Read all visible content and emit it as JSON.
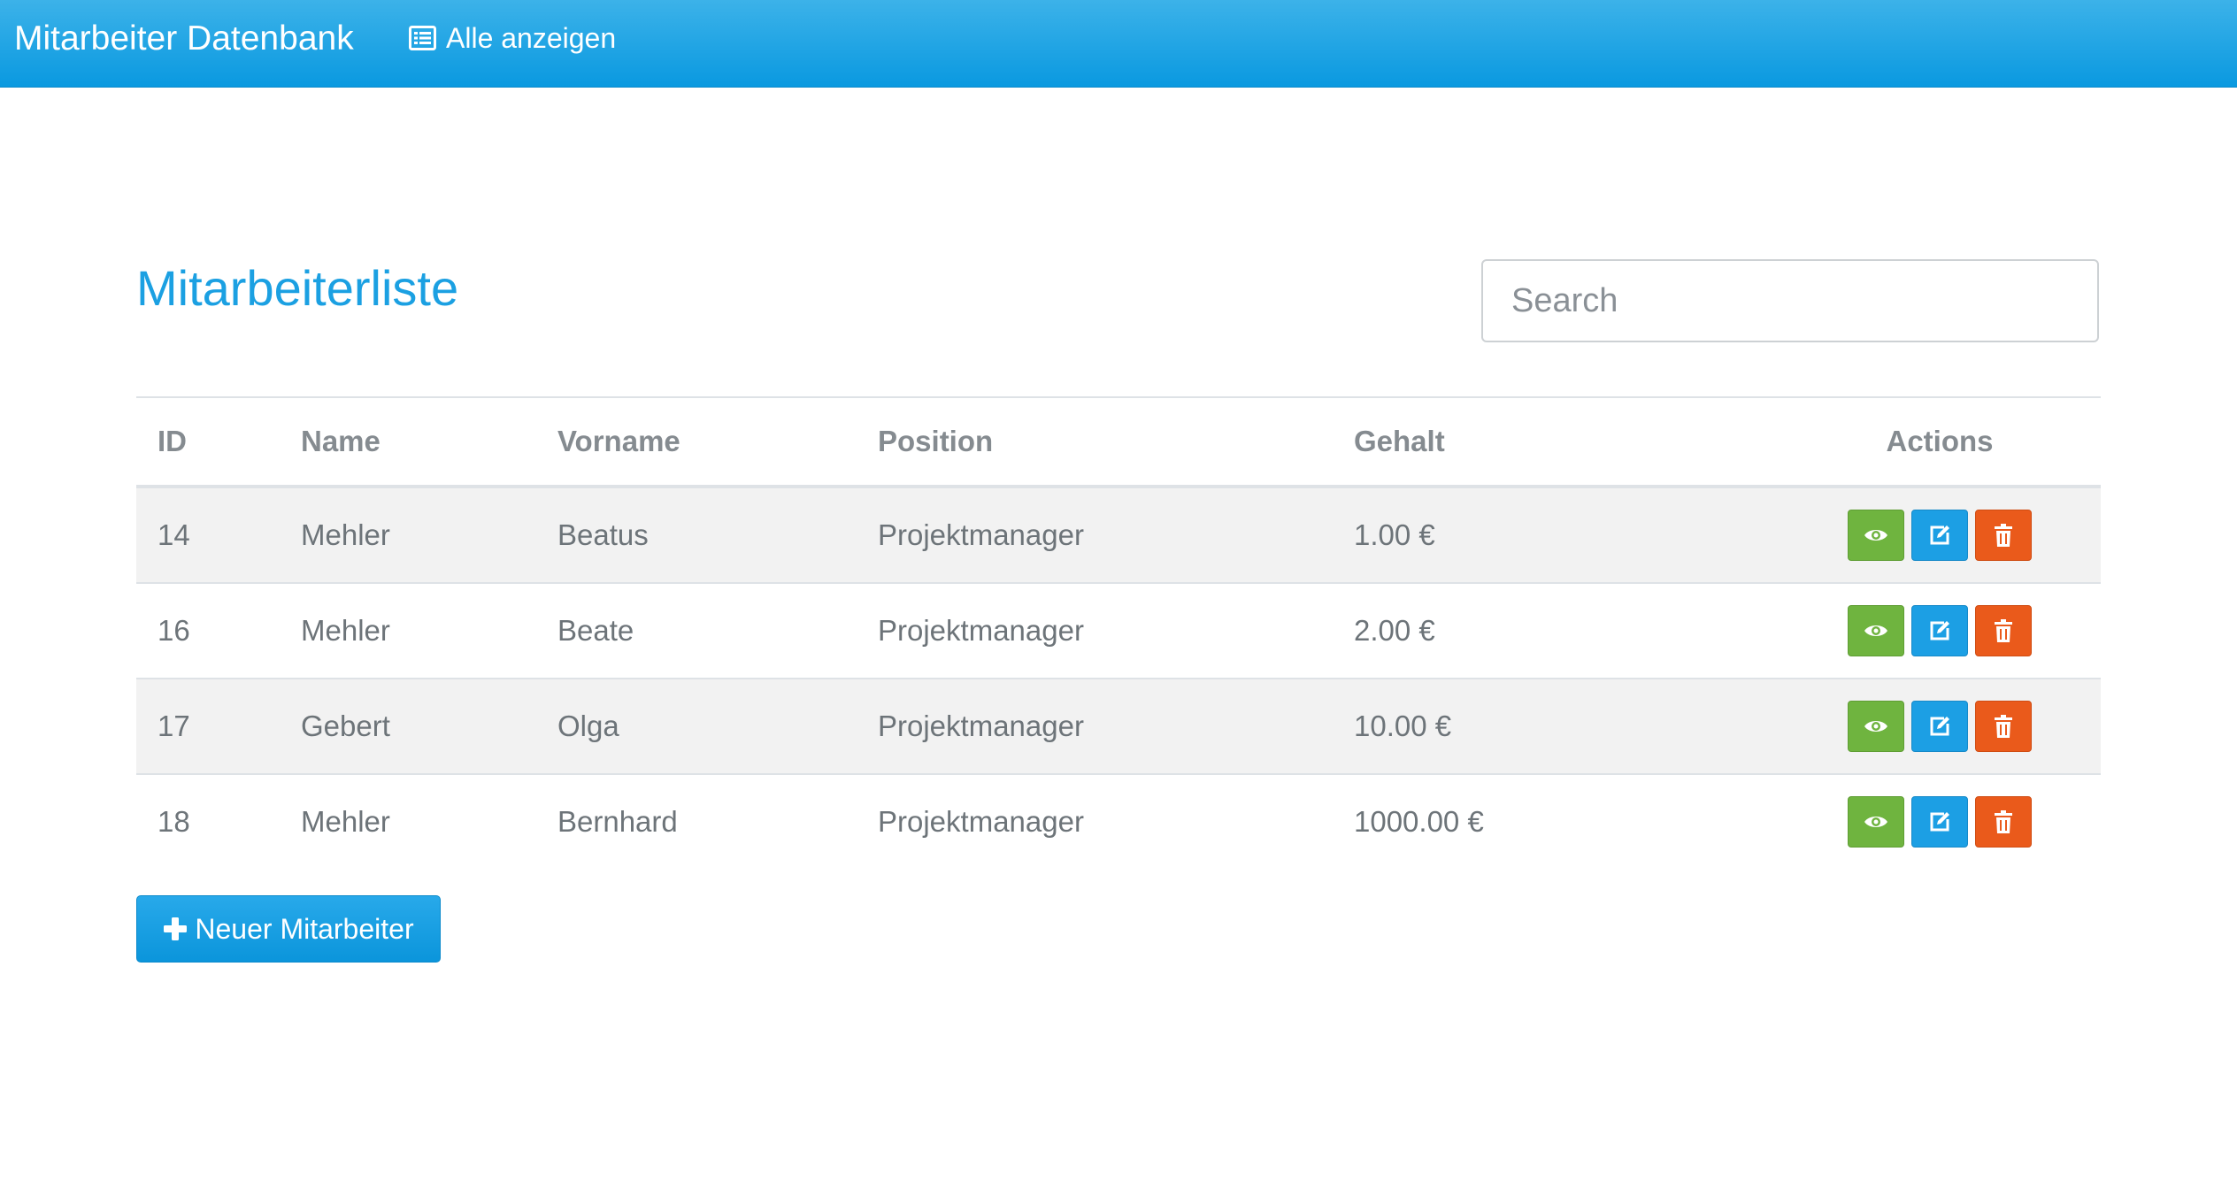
{
  "navbar": {
    "brand": "Mitarbeiter Datenbank",
    "link_label": "Alle anzeigen",
    "link_icon": "list-icon"
  },
  "main": {
    "title": "Mitarbeiterliste",
    "search_placeholder": "Search",
    "new_button_label": "Neuer Mitarbeiter",
    "new_button_icon": "plus-icon"
  },
  "table": {
    "headers": {
      "id": "ID",
      "name": "Name",
      "vorname": "Vorname",
      "position": "Position",
      "gehalt": "Gehalt",
      "actions": "Actions"
    },
    "rows": [
      {
        "id": "14",
        "name": "Mehler",
        "vorname": "Beatus",
        "position": "Projektmanager",
        "gehalt": "1.00 €"
      },
      {
        "id": "16",
        "name": "Mehler",
        "vorname": "Beate",
        "position": "Projektmanager",
        "gehalt": "2.00 €"
      },
      {
        "id": "17",
        "name": "Gebert",
        "vorname": "Olga",
        "position": "Projektmanager",
        "gehalt": "10.00 €"
      },
      {
        "id": "18",
        "name": "Mehler",
        "vorname": "Bernhard",
        "position": "Projektmanager",
        "gehalt": "1000.00 €"
      }
    ],
    "action_icons": [
      "eye-icon",
      "edit-icon",
      "trash-icon"
    ]
  },
  "colors": {
    "accent": "#1ba0e2",
    "navbar": "#1aa3e6",
    "view_button": "#6fb43f",
    "edit_button": "#1c9fe4",
    "delete_button": "#ea5a1b"
  }
}
